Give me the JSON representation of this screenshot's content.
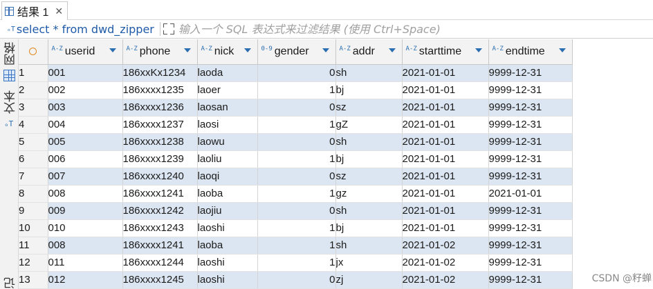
{
  "tab": {
    "label": "结果 1",
    "close": "✕"
  },
  "filter": {
    "sql_icon": "ₒT",
    "sql": "select * from dwd_zipper",
    "placeholder": "输入一个 SQL 表达式来过滤结果 (使用 Ctrl+Space)"
  },
  "side": {
    "grid_label": "网格",
    "text_label": "文本",
    "text_icon": "ₒT",
    "record_label": "记录"
  },
  "columns": [
    {
      "name": "userid",
      "type": "A-Z"
    },
    {
      "name": "phone",
      "type": "A-Z"
    },
    {
      "name": "nick",
      "type": "A-Z"
    },
    {
      "name": "gender",
      "type": "0-9"
    },
    {
      "name": "addr",
      "type": "A-Z"
    },
    {
      "name": "starttime",
      "type": "A-Z"
    },
    {
      "name": "endtime",
      "type": "A-Z"
    }
  ],
  "rows": [
    {
      "n": "1",
      "userid": "001",
      "phone": "186xxKx1234",
      "nick": "laoda",
      "gender": "0",
      "addr": "sh",
      "starttime": "2021-01-01",
      "endtime": "9999-12-31"
    },
    {
      "n": "2",
      "userid": "002",
      "phone": "186xxxx1235",
      "nick": "laoer",
      "gender": "1",
      "addr": "bj",
      "starttime": "2021-01-01",
      "endtime": "9999-12-31"
    },
    {
      "n": "3",
      "userid": "003",
      "phone": "186xxxx1236",
      "nick": "laosan",
      "gender": "0",
      "addr": "sz",
      "starttime": "2021-01-01",
      "endtime": "9999-12-31"
    },
    {
      "n": "4",
      "userid": "004",
      "phone": "186xxxx1237",
      "nick": "laosi",
      "gender": "1",
      "addr": "gZ",
      "starttime": "2021-01-01",
      "endtime": "9999-12-31"
    },
    {
      "n": "5",
      "userid": "005",
      "phone": "186xxxx1238",
      "nick": "laowu",
      "gender": "0",
      "addr": "sh",
      "starttime": "2021-01-01",
      "endtime": "9999-12-31"
    },
    {
      "n": "6",
      "userid": "006",
      "phone": "186xxxx1239",
      "nick": "laoliu",
      "gender": "1",
      "addr": "bj",
      "starttime": "2021-01-01",
      "endtime": "9999-12-31"
    },
    {
      "n": "7",
      "userid": "007",
      "phone": "186xxxx1240",
      "nick": "laoqi",
      "gender": "0",
      "addr": "sz",
      "starttime": "2021-01-01",
      "endtime": "9999-12-31"
    },
    {
      "n": "8",
      "userid": "008",
      "phone": "186xxxx1241",
      "nick": "laoba",
      "gender": "1",
      "addr": "gz",
      "starttime": "2021-01-01",
      "endtime": "2021-01-01"
    },
    {
      "n": "9",
      "userid": "009",
      "phone": "186xxxx1242",
      "nick": "laojiu",
      "gender": "0",
      "addr": "sh",
      "starttime": "2021-01-01",
      "endtime": "9999-12-31"
    },
    {
      "n": "10",
      "userid": "010",
      "phone": "186xxxx1243",
      "nick": "laoshi",
      "gender": "1",
      "addr": "bj",
      "starttime": "2021-01-01",
      "endtime": "9999-12-31"
    },
    {
      "n": "11",
      "userid": "008",
      "phone": "186xxxx1241",
      "nick": "laoba",
      "gender": "1",
      "addr": "sh",
      "starttime": "2021-01-02",
      "endtime": "9999-12-31"
    },
    {
      "n": "12",
      "userid": "011",
      "phone": "186xxxx1244",
      "nick": "laoshi",
      "gender": "1",
      "addr": "jx",
      "starttime": "2021-01-02",
      "endtime": "9999-12-31"
    },
    {
      "n": "13",
      "userid": "012",
      "phone": "186xxxx1245",
      "nick": "laoshi",
      "gender": "0",
      "addr": "zj",
      "starttime": "2021-01-02",
      "endtime": "9999-12-31"
    }
  ],
  "watermark": "CSDN @籽蝉"
}
